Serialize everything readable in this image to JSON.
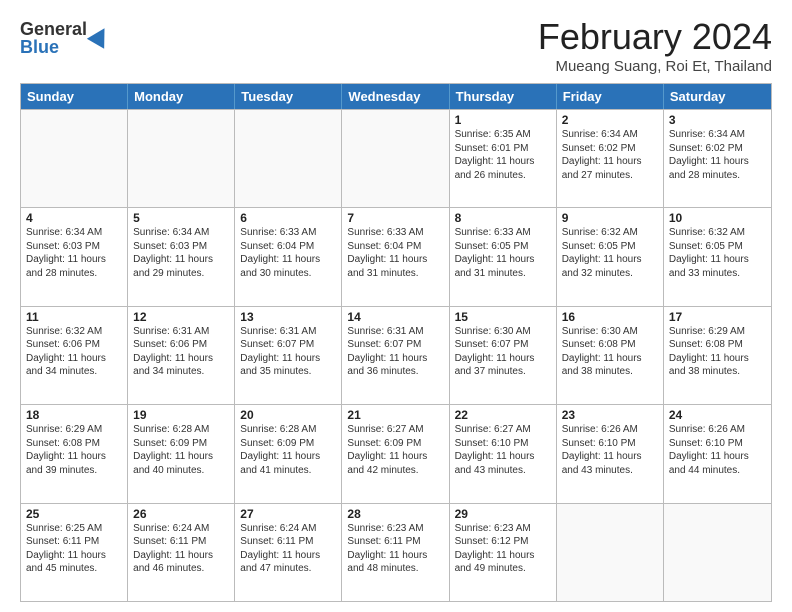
{
  "logo": {
    "general": "General",
    "blue": "Blue"
  },
  "title": "February 2024",
  "location": "Mueang Suang, Roi Et, Thailand",
  "header_days": [
    "Sunday",
    "Monday",
    "Tuesday",
    "Wednesday",
    "Thursday",
    "Friday",
    "Saturday"
  ],
  "weeks": [
    [
      {
        "day": "",
        "info": ""
      },
      {
        "day": "",
        "info": ""
      },
      {
        "day": "",
        "info": ""
      },
      {
        "day": "",
        "info": ""
      },
      {
        "day": "1",
        "info": "Sunrise: 6:35 AM\nSunset: 6:01 PM\nDaylight: 11 hours and 26 minutes."
      },
      {
        "day": "2",
        "info": "Sunrise: 6:34 AM\nSunset: 6:02 PM\nDaylight: 11 hours and 27 minutes."
      },
      {
        "day": "3",
        "info": "Sunrise: 6:34 AM\nSunset: 6:02 PM\nDaylight: 11 hours and 28 minutes."
      }
    ],
    [
      {
        "day": "4",
        "info": "Sunrise: 6:34 AM\nSunset: 6:03 PM\nDaylight: 11 hours and 28 minutes."
      },
      {
        "day": "5",
        "info": "Sunrise: 6:34 AM\nSunset: 6:03 PM\nDaylight: 11 hours and 29 minutes."
      },
      {
        "day": "6",
        "info": "Sunrise: 6:33 AM\nSunset: 6:04 PM\nDaylight: 11 hours and 30 minutes."
      },
      {
        "day": "7",
        "info": "Sunrise: 6:33 AM\nSunset: 6:04 PM\nDaylight: 11 hours and 31 minutes."
      },
      {
        "day": "8",
        "info": "Sunrise: 6:33 AM\nSunset: 6:05 PM\nDaylight: 11 hours and 31 minutes."
      },
      {
        "day": "9",
        "info": "Sunrise: 6:32 AM\nSunset: 6:05 PM\nDaylight: 11 hours and 32 minutes."
      },
      {
        "day": "10",
        "info": "Sunrise: 6:32 AM\nSunset: 6:05 PM\nDaylight: 11 hours and 33 minutes."
      }
    ],
    [
      {
        "day": "11",
        "info": "Sunrise: 6:32 AM\nSunset: 6:06 PM\nDaylight: 11 hours and 34 minutes."
      },
      {
        "day": "12",
        "info": "Sunrise: 6:31 AM\nSunset: 6:06 PM\nDaylight: 11 hours and 34 minutes."
      },
      {
        "day": "13",
        "info": "Sunrise: 6:31 AM\nSunset: 6:07 PM\nDaylight: 11 hours and 35 minutes."
      },
      {
        "day": "14",
        "info": "Sunrise: 6:31 AM\nSunset: 6:07 PM\nDaylight: 11 hours and 36 minutes."
      },
      {
        "day": "15",
        "info": "Sunrise: 6:30 AM\nSunset: 6:07 PM\nDaylight: 11 hours and 37 minutes."
      },
      {
        "day": "16",
        "info": "Sunrise: 6:30 AM\nSunset: 6:08 PM\nDaylight: 11 hours and 38 minutes."
      },
      {
        "day": "17",
        "info": "Sunrise: 6:29 AM\nSunset: 6:08 PM\nDaylight: 11 hours and 38 minutes."
      }
    ],
    [
      {
        "day": "18",
        "info": "Sunrise: 6:29 AM\nSunset: 6:08 PM\nDaylight: 11 hours and 39 minutes."
      },
      {
        "day": "19",
        "info": "Sunrise: 6:28 AM\nSunset: 6:09 PM\nDaylight: 11 hours and 40 minutes."
      },
      {
        "day": "20",
        "info": "Sunrise: 6:28 AM\nSunset: 6:09 PM\nDaylight: 11 hours and 41 minutes."
      },
      {
        "day": "21",
        "info": "Sunrise: 6:27 AM\nSunset: 6:09 PM\nDaylight: 11 hours and 42 minutes."
      },
      {
        "day": "22",
        "info": "Sunrise: 6:27 AM\nSunset: 6:10 PM\nDaylight: 11 hours and 43 minutes."
      },
      {
        "day": "23",
        "info": "Sunrise: 6:26 AM\nSunset: 6:10 PM\nDaylight: 11 hours and 43 minutes."
      },
      {
        "day": "24",
        "info": "Sunrise: 6:26 AM\nSunset: 6:10 PM\nDaylight: 11 hours and 44 minutes."
      }
    ],
    [
      {
        "day": "25",
        "info": "Sunrise: 6:25 AM\nSunset: 6:11 PM\nDaylight: 11 hours and 45 minutes."
      },
      {
        "day": "26",
        "info": "Sunrise: 6:24 AM\nSunset: 6:11 PM\nDaylight: 11 hours and 46 minutes."
      },
      {
        "day": "27",
        "info": "Sunrise: 6:24 AM\nSunset: 6:11 PM\nDaylight: 11 hours and 47 minutes."
      },
      {
        "day": "28",
        "info": "Sunrise: 6:23 AM\nSunset: 6:11 PM\nDaylight: 11 hours and 48 minutes."
      },
      {
        "day": "29",
        "info": "Sunrise: 6:23 AM\nSunset: 6:12 PM\nDaylight: 11 hours and 49 minutes."
      },
      {
        "day": "",
        "info": ""
      },
      {
        "day": "",
        "info": ""
      }
    ]
  ]
}
